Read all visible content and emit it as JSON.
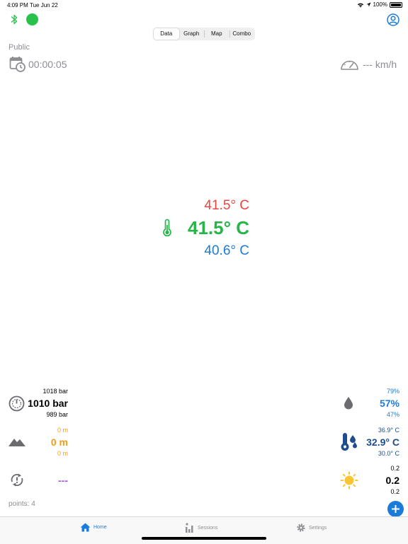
{
  "status_bar": {
    "time": "4:09 PM",
    "date": "Tue Jun 22",
    "battery": "100%"
  },
  "segments": [
    {
      "label": "Data",
      "active": true
    },
    {
      "label": "Graph",
      "active": false
    },
    {
      "label": "Map",
      "active": false
    },
    {
      "label": "Combo",
      "active": false
    }
  ],
  "session": {
    "visibility": "Public",
    "duration": "00:00:05",
    "speed": "--- km/h"
  },
  "temperature": {
    "max": "41.5° C",
    "current": "41.5° C",
    "min": "40.6° C"
  },
  "pressure": {
    "max": "1018 bar",
    "current": "1010 bar",
    "min": "989 bar"
  },
  "humidity": {
    "max": "79%",
    "current": "57%",
    "min": "47%"
  },
  "altitude": {
    "max": "0 m",
    "current": "0 m",
    "min": "0 m"
  },
  "dew_point": {
    "max": "36.9° C",
    "current": "32.9° C",
    "min": "30.0° C"
  },
  "rotation": {
    "current": "---"
  },
  "uv": {
    "max": "0.2",
    "current": "0.2",
    "min": "0.2"
  },
  "points": "points: 4",
  "tabs": [
    {
      "label": "Home",
      "active": true
    },
    {
      "label": "Sessions",
      "active": false
    },
    {
      "label": "Settings",
      "active": false
    }
  ],
  "colors": {
    "accent": "#1a7bd8",
    "connected": "#27c24c",
    "max": "#e9433e",
    "current": "#27b54a",
    "min": "#1a7bd8"
  }
}
